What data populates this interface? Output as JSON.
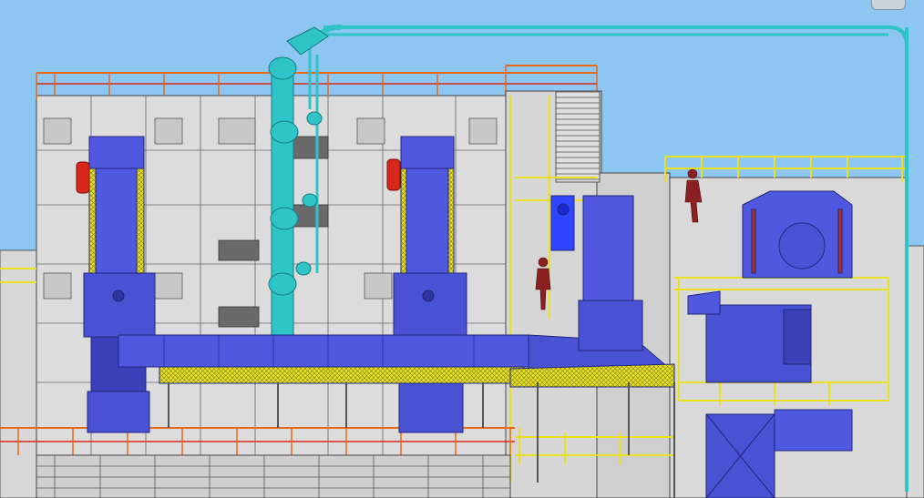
{
  "viewport": {
    "view_cube_label": "",
    "colors": {
      "sky": "#8ec6f2",
      "building": "#dcdcdc",
      "steel": "#5058e0",
      "steel_dark": "#3a40b8",
      "pipe": "#2ec4c8",
      "railing_yellow": "#e8e020",
      "railing_orange": "#e86a18",
      "railing_red": "#d8281c",
      "human_figure": "#8a2020"
    },
    "icons": [
      "view-cube-icon",
      "human-figure-icon",
      "valve-icon"
    ]
  }
}
